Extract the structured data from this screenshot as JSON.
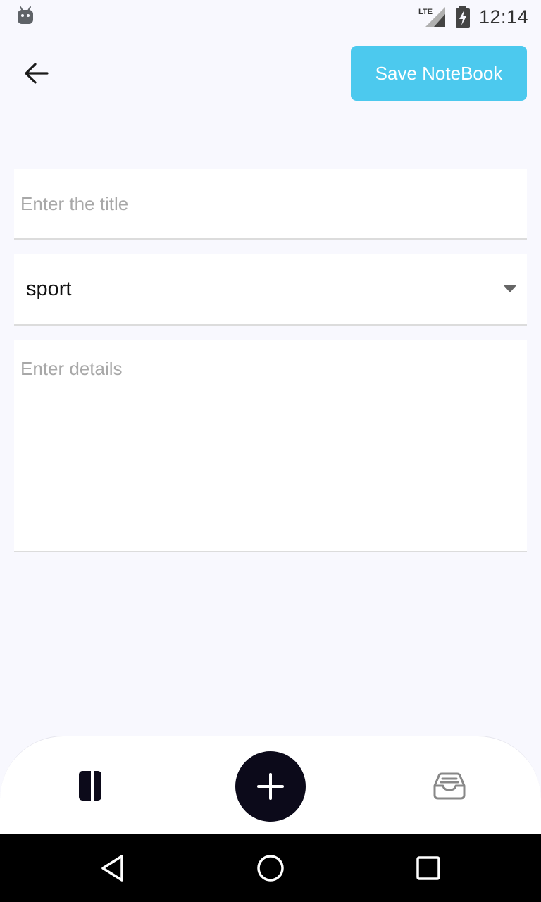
{
  "status_bar": {
    "time": "12:14",
    "network_label": "LTE"
  },
  "header": {
    "save_label": "Save NoteBook"
  },
  "form": {
    "title_placeholder": "Enter the title",
    "category_value": "sport",
    "details_placeholder": "Enter details"
  },
  "colors": {
    "accent": "#4CC9EE",
    "fab": "#0C0A1A",
    "background": "#F8F8FE"
  },
  "icons": {
    "back": "arrow-left-icon",
    "dropdown": "caret-down-icon",
    "notebooks": "notebook-icon",
    "add": "plus-icon",
    "archive": "inbox-tray-icon"
  }
}
